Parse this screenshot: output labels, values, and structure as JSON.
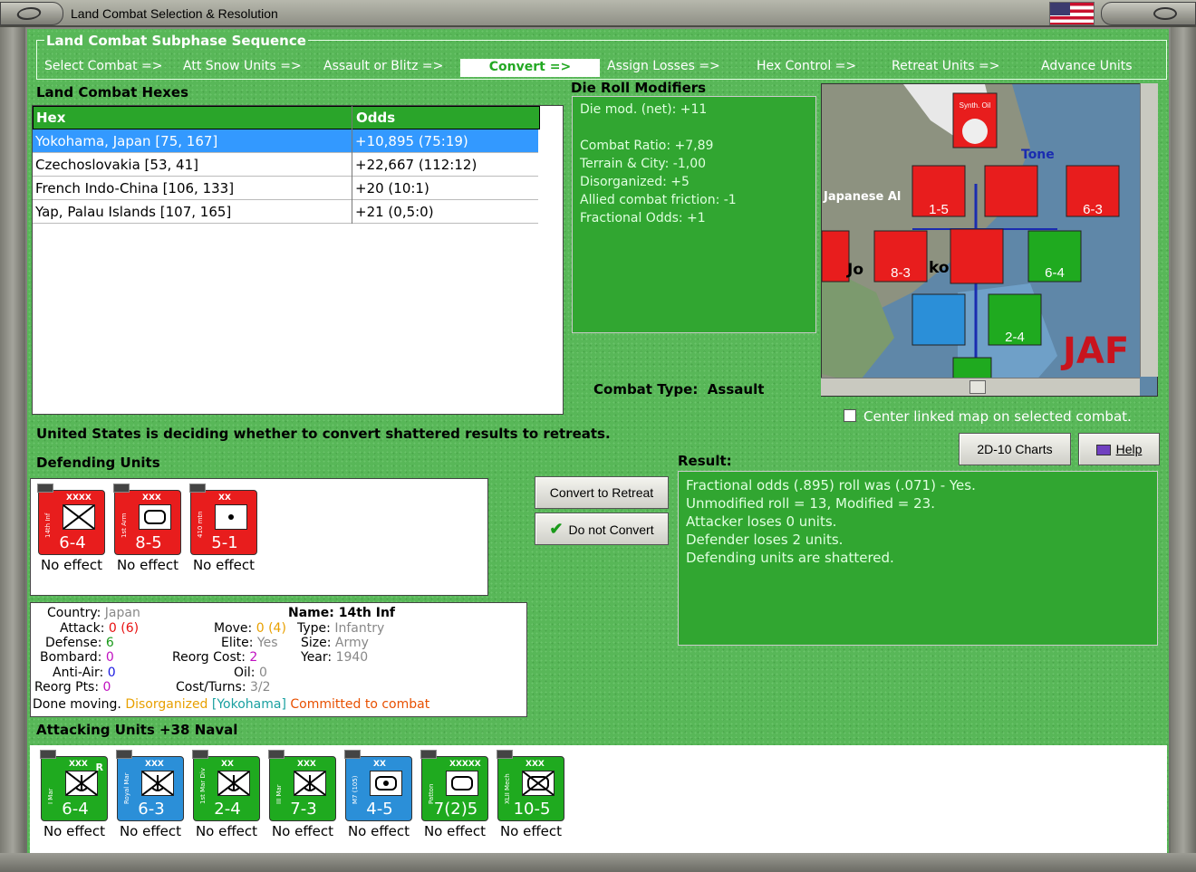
{
  "window": {
    "title": "Land Combat Selection & Resolution"
  },
  "sequence": {
    "legend": "Land Combat Subphase Sequence",
    "steps": [
      "Select Combat =>",
      "Att Snow Units =>",
      "Assault or Blitz =>",
      "Convert =>",
      "Assign Losses =>",
      "Hex Control =>",
      "Retreat Units =>",
      "Advance Units"
    ],
    "active_index": 3
  },
  "hexes": {
    "label": "Land Combat Hexes",
    "col_hex": "Hex",
    "col_odds": "Odds",
    "rows": [
      {
        "hex": "Yokohama, Japan [75, 167]",
        "odds": "+10,895 (75:19)"
      },
      {
        "hex": "Czechoslovakia [53, 41]",
        "odds": "+22,667 (112:12)"
      },
      {
        "hex": "French Indo-China [106, 133]",
        "odds": "+20 (10:1)"
      },
      {
        "hex": "Yap, Palau Islands [107, 165]",
        "odds": "+21 (0,5:0)"
      }
    ]
  },
  "modifiers": {
    "label": "Die Roll Modifiers",
    "net": "Die mod. (net): +11",
    "lines": [
      "Combat Ratio: +7,89",
      "Terrain & City: -1,00",
      "Disorganized: +5",
      "Allied combat friction: -1",
      "Fractional Odds: +1"
    ]
  },
  "combat_type": {
    "label": "Combat Type:",
    "value": "Assault"
  },
  "center_map": "Center linked map on selected combat.",
  "status_msg": "United States is deciding whether to convert shattered results to retreats.",
  "buttons": {
    "charts": "2D-10 Charts",
    "help": "Help",
    "convert": "Convert to Retreat",
    "no_convert": "Do not Convert"
  },
  "defending": {
    "label": "Defending Units",
    "units": [
      {
        "name": "14th Inf",
        "size": "XXXX",
        "stat": "6-4",
        "effect": "No effect",
        "color": "#e81d1d",
        "symbol": "infantry"
      },
      {
        "name": "1st Arm",
        "size": "XXX",
        "stat": "8-5",
        "effect": "No effect",
        "color": "#e81d1d",
        "symbol": "armor"
      },
      {
        "name": "410 mtn",
        "size": "XX",
        "stat": "5-1",
        "effect": "No effect",
        "color": "#e81d1d",
        "symbol": "artillery"
      }
    ]
  },
  "info": {
    "country_k": "Country:",
    "country_v": "Japan",
    "attack_k": "Attack:",
    "attack_v": "0",
    "attack_v2": "(6)",
    "defense_k": "Defense:",
    "defense_v": "6",
    "bombard_k": "Bombard:",
    "bombard_v": "0",
    "antiair_k": "Anti-Air:",
    "antiair_v": "0",
    "reorg_k": "Reorg Pts:",
    "reorg_v": "0",
    "move_k": "Move:",
    "move_v": "0",
    "move_v2": "(4)",
    "elite_k": "Elite:",
    "elite_v": "Yes",
    "reorgcost_k": "Reorg Cost:",
    "reorgcost_v": "2",
    "oil_k": "Oil:",
    "oil_v": "0",
    "cost_k": "Cost/Turns:",
    "cost_v": "3/2",
    "name_k": "Name:",
    "name_v": "14th Inf",
    "type_k": "Type:",
    "type_v": "Infantry",
    "size_k": "Size:",
    "size_v": "Army",
    "year_k": "Year:",
    "year_v": "1940",
    "done": "Done moving.",
    "disorg": "Disorganized",
    "loc": "[Yokohama]",
    "committed": "Committed to combat"
  },
  "result": {
    "label": "Result:",
    "lines": [
      "Fractional odds (.895) roll was (.071)  - Yes.",
      "Unmodified roll = 13, Modified = 23.",
      "Attacker loses 0 units.",
      "Defender loses 2 units.",
      "Defending units are shattered."
    ]
  },
  "attacking": {
    "label": "Attacking Units +38 Naval",
    "units": [
      {
        "name": "I Mar",
        "size": "XXX",
        "stat": "6-4",
        "effect": "No effect",
        "color": "#1faa1f"
      },
      {
        "name": "Royal Mar",
        "size": "XXX",
        "stat": "6-3",
        "effect": "No effect",
        "color": "#1faa1f"
      },
      {
        "name": "1st Mar Div",
        "size": "XX",
        "stat": "2-4",
        "effect": "No effect",
        "color": "#1faa1f"
      },
      {
        "name": "III Mar",
        "size": "XXX",
        "stat": "7-3",
        "effect": "No effect",
        "color": "#1faa1f"
      },
      {
        "name": "M7 (105)",
        "size": "XX",
        "stat": "4-5",
        "effect": "No effect",
        "color": "#2b8fd8"
      },
      {
        "name": "Patton",
        "size": "XXXXX",
        "stat": "7(2)5",
        "effect": "No effect",
        "color": "#1faa1f"
      },
      {
        "name": "XLII Mech",
        "size": "XXX",
        "stat": "10-5",
        "effect": "No effect",
        "color": "#1faa1f"
      }
    ]
  },
  "map": {
    "labels": [
      "Japanese Al",
      "Tone",
      "JAF",
      "Synth. Oil",
      "Jo",
      "ko"
    ],
    "counters": [
      {
        "stat": "1-5",
        "color": "#e81d1d"
      },
      {
        "stat": "6-3",
        "color": "#e81d1d"
      },
      {
        "stat": "8-3",
        "color": "#e81d1d"
      },
      {
        "stat": "6-4",
        "color": "#1faa1f"
      },
      {
        "stat": "2-4",
        "color": "#1faa1f"
      }
    ]
  }
}
